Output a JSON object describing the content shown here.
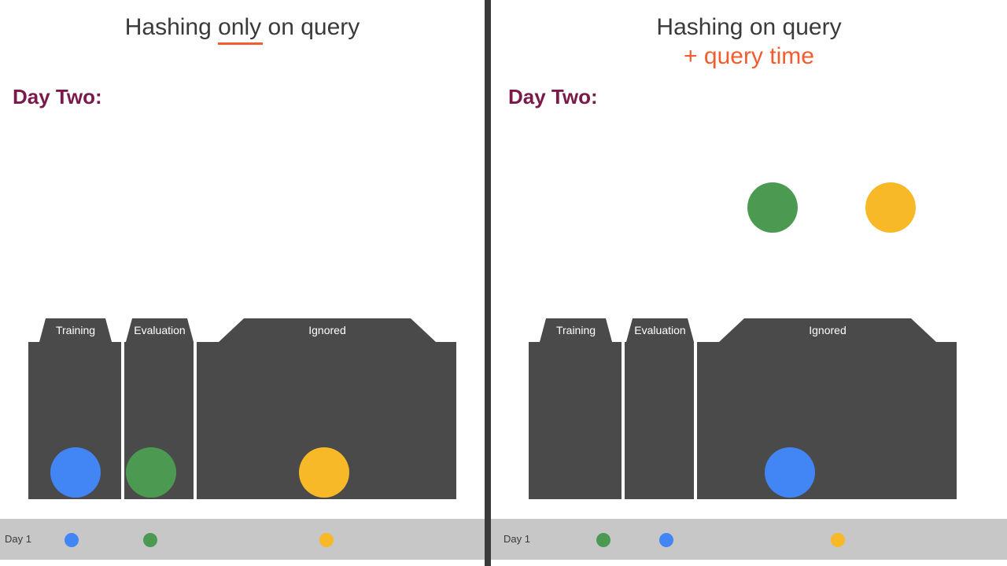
{
  "left": {
    "title_prefix": "Hashing ",
    "title_under": "only",
    "title_suffix": " on query",
    "day_label": "Day Two:",
    "buckets": {
      "training": "Training",
      "evaluation": "Evaluation",
      "ignored": "Ignored"
    },
    "footer_label": "Day 1"
  },
  "right": {
    "title_main": "Hashing on query",
    "title_sub": "+ query time",
    "day_label": "Day Two:",
    "buckets": {
      "training": "Training",
      "evaluation": "Evaluation",
      "ignored": "Ignored"
    },
    "footer_label": "Day 1"
  },
  "colors": {
    "blue": "#4285f4",
    "green": "#4c9a52",
    "yellow": "#f7b927",
    "dark": "#4a4a4a",
    "accent": "#f25c2e",
    "plum": "#7a1a4a"
  }
}
